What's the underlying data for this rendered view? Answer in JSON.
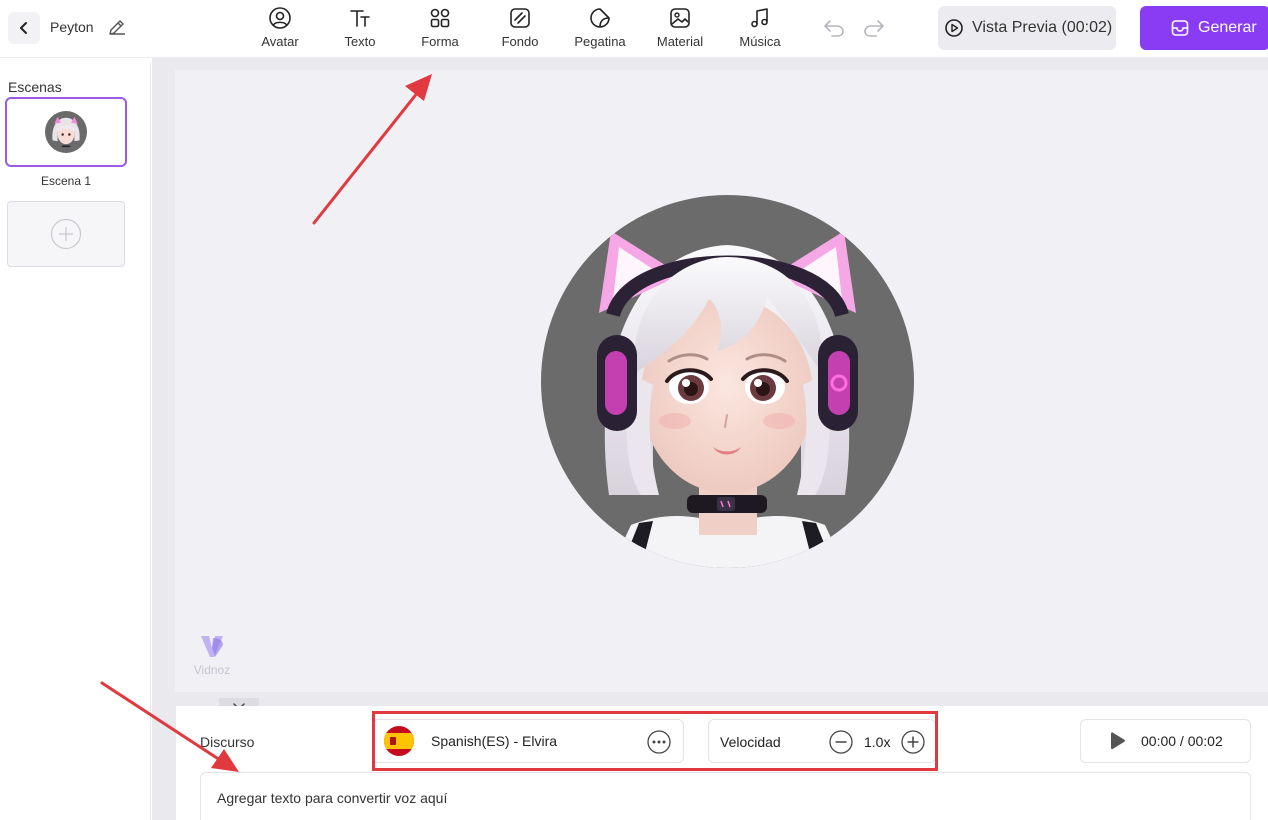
{
  "header": {
    "project_name": "Peyton",
    "tools": [
      {
        "label": "Avatar",
        "icon": "user-circle-icon"
      },
      {
        "label": "Texto",
        "icon": "text-icon"
      },
      {
        "label": "Forma",
        "icon": "shapes-icon"
      },
      {
        "label": "Fondo",
        "icon": "background-icon"
      },
      {
        "label": "Pegatina",
        "icon": "sticker-icon"
      },
      {
        "label": "Material",
        "icon": "image-icon"
      },
      {
        "label": "Música",
        "icon": "music-icon"
      }
    ],
    "preview_label": "Vista Previa (00:02)",
    "generate_label": "Generar"
  },
  "sidebar": {
    "title": "Escenas",
    "scenes": [
      {
        "label": "Escena 1"
      }
    ]
  },
  "canvas": {
    "watermark": "Vidnoz"
  },
  "speech": {
    "label": "Discurso",
    "voice": "Spanish(ES) - Elvira",
    "speed_label": "Velocidad",
    "speed_value": "1.0x",
    "time": "00:00 / 00:02",
    "placeholder": "Agregar texto para convertir voz aquí"
  },
  "colors": {
    "accent": "#8a3cf5",
    "scene_border": "#9b59e8",
    "annotation_red": "#e0393e",
    "canvas_bg": "#f0f0f5"
  }
}
